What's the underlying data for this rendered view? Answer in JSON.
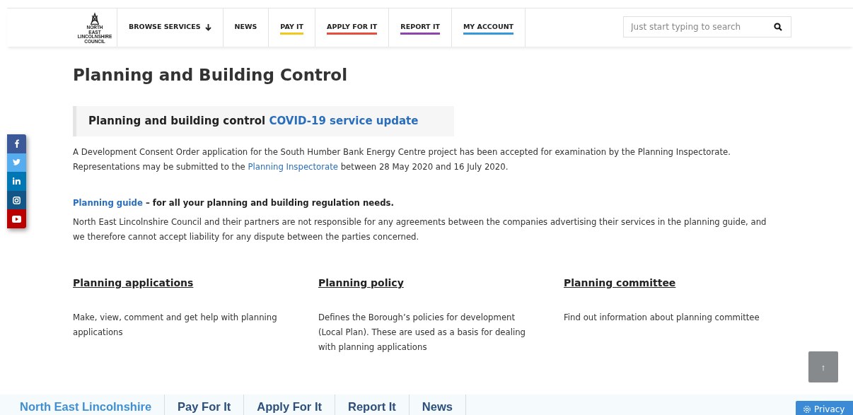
{
  "logo": {
    "lines": [
      "NORTH",
      "EAST",
      "LINCOLNSHIRE",
      "COUNCIL"
    ]
  },
  "nav": [
    {
      "label": "BROWSE SERVICES",
      "kind": "dropdown"
    },
    {
      "label": "NEWS",
      "kind": "plain"
    },
    {
      "label": "PAY IT",
      "kind": "accent",
      "color": "#f2c81e"
    },
    {
      "label": "APPLY FOR IT",
      "kind": "accent",
      "color": "#e84c3d"
    },
    {
      "label": "REPORT IT",
      "kind": "accent",
      "color": "#8e44ad"
    },
    {
      "label": "MY ACCOUNT",
      "kind": "accent",
      "color": "#3498db"
    }
  ],
  "search": {
    "placeholder": "Just start typing to search"
  },
  "social": [
    {
      "kind": "facebook",
      "color": "#3b5998"
    },
    {
      "kind": "twitter",
      "color": "#55acee"
    },
    {
      "kind": "linkedin",
      "color": "#0077b5"
    },
    {
      "kind": "instagram",
      "color": "#125688"
    },
    {
      "kind": "youtube",
      "color": "#bb0000"
    }
  ],
  "title": "Planning and Building Control",
  "callout": {
    "text": "Planning and building control",
    "link": "COVID-19 service update"
  },
  "notice": {
    "line1": "A Development Consent Order application for the South Humber Bank Energy Centre project has been accepted for examination by the Planning Inspectorate.",
    "before": "Representations may be submitted to the",
    "link": "Planning Inspectorate",
    "after": "between 28 May 2020 and 16 July 2020."
  },
  "guide": {
    "link": "Planning guide",
    "text": "– for all your planning and building regulation needs.",
    "disclaimer": "North East Lincolnshire Council and their partners are not responsible for any agreements between the companies advertising their services in the planning guide, and we therefore cannot accept liability for any dispute between the parties concerned."
  },
  "sections": [
    {
      "title": "Planning applications",
      "text": "Make, view, comment and get help with planning applications"
    },
    {
      "title": "Planning policy",
      "text": "Defines the Borough’s policies for development (Local Plan). These are used as a basis for dealing with planning applications"
    },
    {
      "title": "Planning committee",
      "text": "Find out information about planning committee"
    }
  ],
  "back_to_top": "↑",
  "footer": [
    {
      "label": "North East Lincolnshire",
      "selected": true
    },
    {
      "label": "Pay For It",
      "selected": false
    },
    {
      "label": "Apply For It",
      "selected": false
    },
    {
      "label": "Report It",
      "selected": false
    },
    {
      "label": "News",
      "selected": false
    }
  ],
  "privacy": "Privacy"
}
